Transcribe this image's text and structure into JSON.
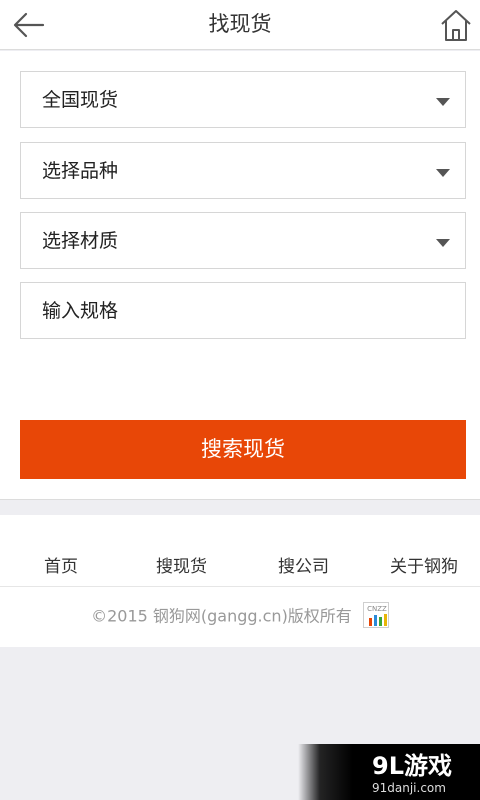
{
  "header": {
    "title": "找现货",
    "back_icon": "arrow-left-icon",
    "home_icon": "home-icon"
  },
  "form": {
    "region_select": "全国现货",
    "variety_select": "选择品种",
    "material_select": "选择材质",
    "spec_input_placeholder": "输入规格",
    "submit_label": "搜索现货"
  },
  "footer": {
    "nav": [
      "首页",
      "搜现货",
      "搜公司",
      "关于钢狗"
    ],
    "copyright": "©2015 钢狗网(gangg.cn)版权所有",
    "badge_text": "CNZZ"
  },
  "watermark": {
    "logo": "9L游戏",
    "domain": "91danji.com"
  },
  "colors": {
    "accent": "#e84707",
    "text": "#333333",
    "muted": "#999999",
    "background": "#eeeef2"
  }
}
